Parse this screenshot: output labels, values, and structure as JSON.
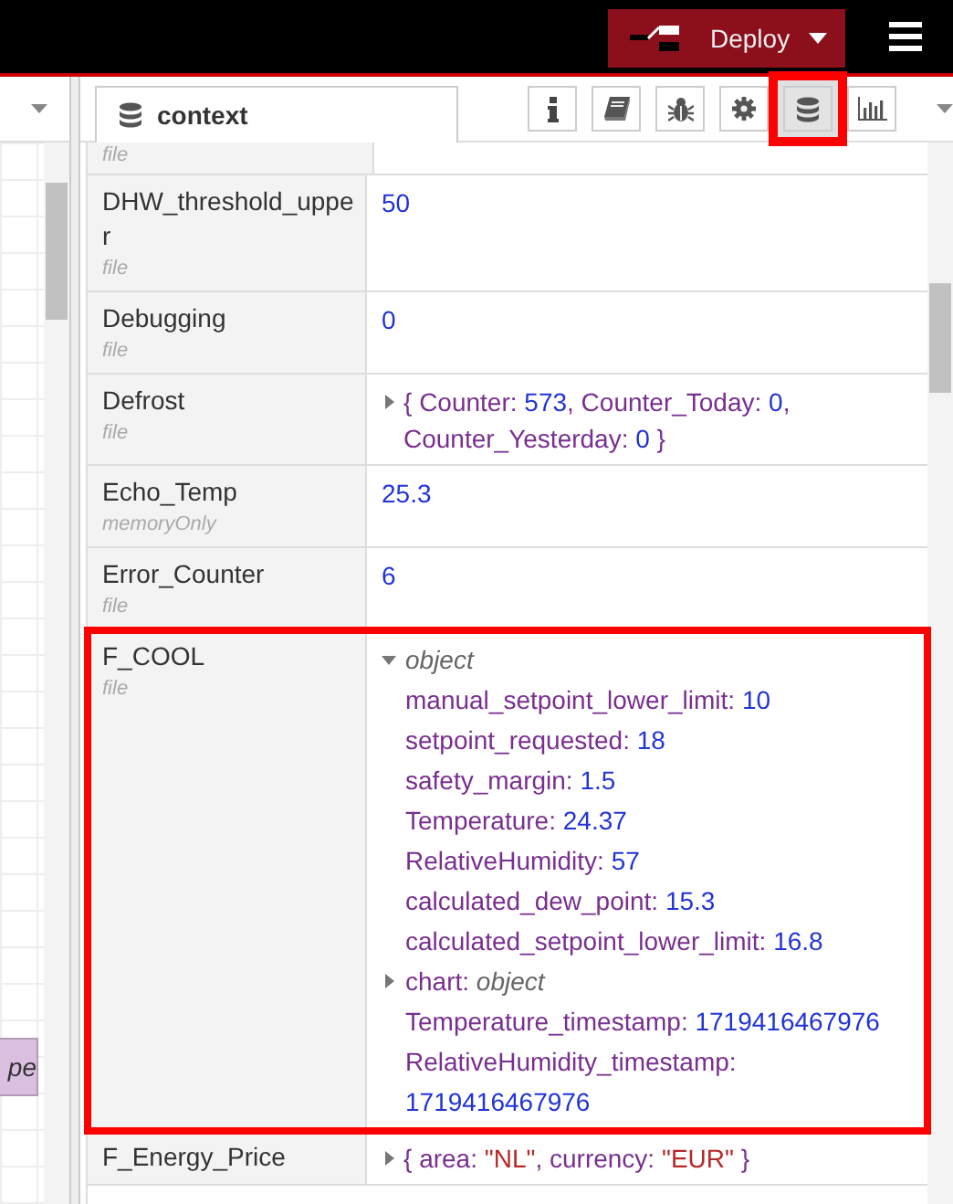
{
  "header": {
    "deploy": {
      "label": "Deploy"
    }
  },
  "canvas": {
    "node_label": "pe"
  },
  "sidebar": {
    "tab": {
      "label": "context",
      "selected": true
    },
    "toolbar": [
      {
        "kind": "info",
        "selected": false,
        "highlighted": false
      },
      {
        "kind": "book",
        "selected": false,
        "highlighted": false
      },
      {
        "kind": "bug",
        "selected": false,
        "highlighted": false
      },
      {
        "kind": "gear",
        "selected": false,
        "highlighted": false
      },
      {
        "kind": "database",
        "selected": true,
        "highlighted": true
      },
      {
        "kind": "chart",
        "selected": false,
        "highlighted": false
      }
    ],
    "rows": [
      {
        "store": "file",
        "kind": "number",
        "value": ""
      },
      {
        "key": "DHW_threshold_upper",
        "store": "file",
        "kind": "number",
        "value": "50",
        "highlighted": false
      },
      {
        "key": "Debugging",
        "store": "file",
        "kind": "number",
        "value": "0",
        "highlighted": false
      },
      {
        "key": "Defrost",
        "store": "file",
        "kind": "inline",
        "expanded": false,
        "highlighted": false,
        "parts": [
          {
            "kind": "key",
            "text": "{ Counter: "
          },
          {
            "kind": "number",
            "text": "573"
          },
          {
            "kind": "key",
            "text": ", Counter_Today: "
          },
          {
            "kind": "number",
            "text": "0"
          },
          {
            "kind": "key",
            "text": ", Counter_Yesterday: "
          },
          {
            "kind": "number",
            "text": "0"
          },
          {
            "kind": "key",
            "text": " }"
          }
        ]
      },
      {
        "key": "Echo_Temp",
        "store": "memoryOnly",
        "kind": "number",
        "value": "25.3",
        "highlighted": false
      },
      {
        "key": "Error_Counter",
        "store": "file",
        "kind": "number",
        "value": "6",
        "highlighted": false
      },
      {
        "key": "F_COOL",
        "store": "file",
        "kind": "tree",
        "expanded": true,
        "type_label": "object",
        "highlighted": true,
        "properties": [
          {
            "key": "manual_setpoint_lower_limit:",
            "value": "10",
            "kind": "number"
          },
          {
            "key": "setpoint_requested:",
            "value": "18",
            "kind": "number"
          },
          {
            "key": "safety_margin:",
            "value": "1.5",
            "kind": "number"
          },
          {
            "key": "Temperature:",
            "value": "24.37",
            "kind": "number"
          },
          {
            "key": "RelativeHumidity:",
            "value": "57",
            "kind": "number"
          },
          {
            "key": "calculated_dew_point:",
            "value": "15.3",
            "kind": "number"
          },
          {
            "key": "calculated_setpoint_lower_limit:",
            "value": "16.8",
            "kind": "number"
          },
          {
            "key": "chart:",
            "value": "object",
            "kind": "object",
            "expanded": false
          },
          {
            "key": "Temperature_timestamp:",
            "value": "1719416467976",
            "kind": "number"
          },
          {
            "key": "RelativeHumidity_timestamp:",
            "value": "1719416467976",
            "kind": "number"
          }
        ]
      },
      {
        "key": "F_Energy_Price",
        "kind": "inline",
        "expanded": false,
        "highlighted": false,
        "parts": [
          {
            "kind": "key",
            "text": "{ area: "
          },
          {
            "kind": "string",
            "text": "\"NL\""
          },
          {
            "kind": "key",
            "text": ", currency: "
          },
          {
            "kind": "string",
            "text": "\"EUR\""
          },
          {
            "kind": "key",
            "text": " }"
          }
        ]
      }
    ]
  }
}
